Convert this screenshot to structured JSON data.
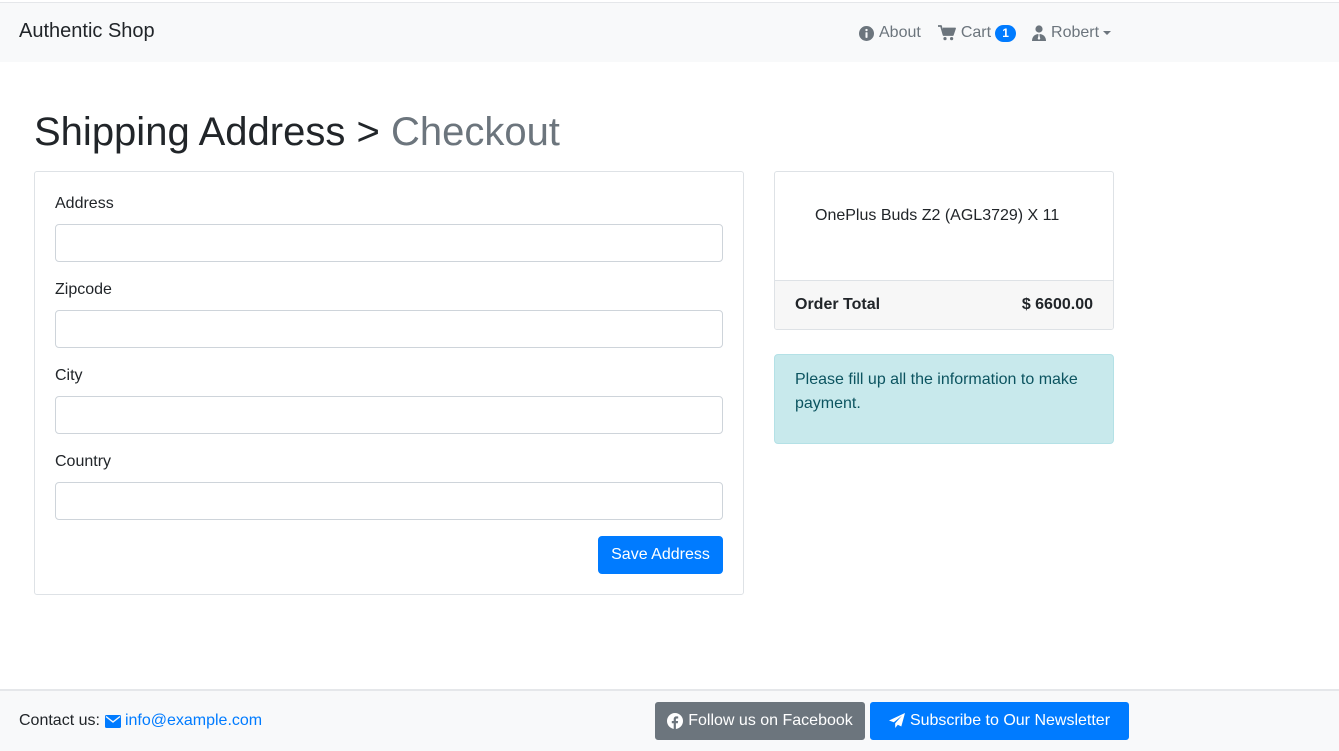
{
  "navbar": {
    "brand": "Authentic Shop",
    "about_label": "About",
    "cart_label": "Cart",
    "cart_count": "1",
    "user_label": "Robert"
  },
  "heading": {
    "main": "Shipping Address >",
    "sub": "Checkout"
  },
  "form": {
    "fields": [
      {
        "label": "Address",
        "value": ""
      },
      {
        "label": "Zipcode",
        "value": ""
      },
      {
        "label": "City",
        "value": ""
      },
      {
        "label": "Country",
        "value": ""
      }
    ],
    "save_label": "Save Address"
  },
  "order": {
    "item": "OnePlus Buds Z2 (AGL3729) X 11",
    "total_label": "Order Total",
    "total_value": "$ 6600.00"
  },
  "alert": {
    "text": "Please fill up all the information to make payment."
  },
  "footer": {
    "contact_label": "Contact us:",
    "email": "info@example.com",
    "facebook_label": "Follow us on Facebook",
    "newsletter_label": "Subscribe to Our Newsletter"
  },
  "colors": {
    "primary": "#007bff",
    "secondary": "#6c757d",
    "navbar_bg": "#f8f9fa",
    "alert_bg": "#c8e9ec",
    "alert_text": "#0c5460"
  },
  "icons": {
    "about": "info-circle-icon",
    "cart": "shopping-cart-icon",
    "user": "user-tie-icon",
    "email": "envelope-icon",
    "facebook": "facebook-icon",
    "newsletter": "paper-plane-icon"
  }
}
